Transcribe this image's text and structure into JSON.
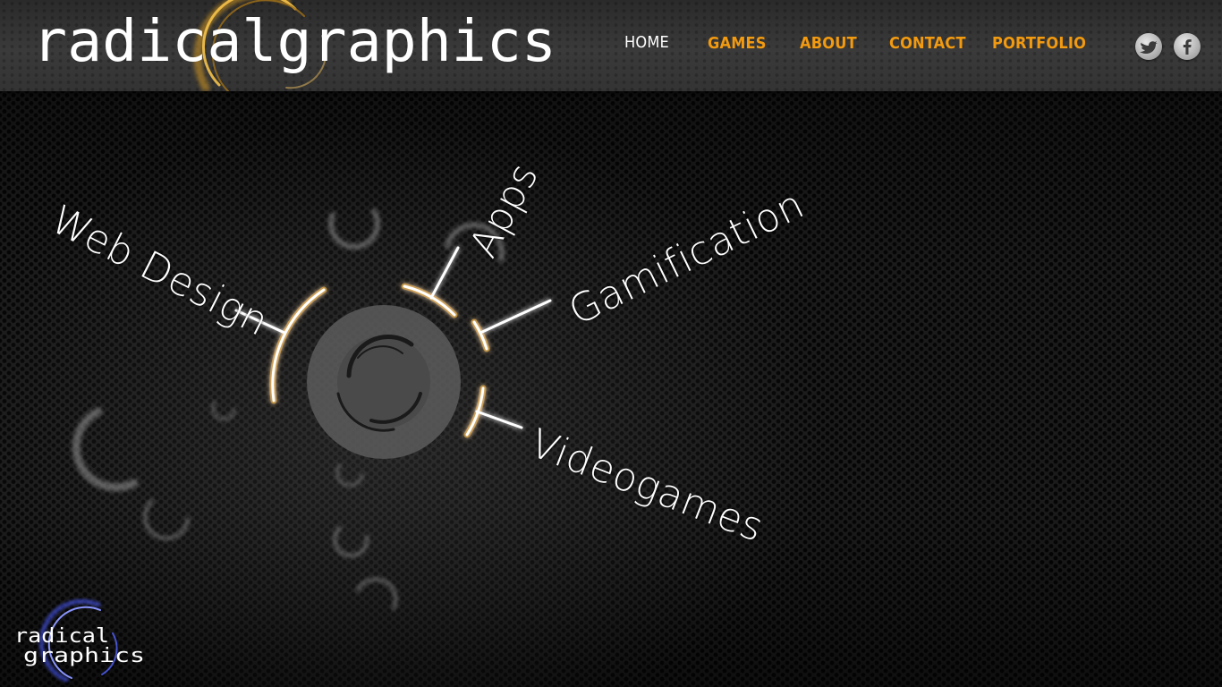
{
  "header": {
    "logo_text": "radicalgraphics",
    "nav": [
      {
        "label": "HOME",
        "active": true
      },
      {
        "label": "GAMES",
        "active": false
      },
      {
        "label": "ABOUT",
        "active": false
      },
      {
        "label": "CONTACT",
        "active": false
      },
      {
        "label": "PORTFOLIO",
        "active": false
      }
    ],
    "social": [
      {
        "name": "twitter-icon"
      },
      {
        "name": "facebook-icon"
      }
    ]
  },
  "hero": {
    "labels": {
      "web_design": "Web Design",
      "apps": "Apps",
      "gamification": "Gamification",
      "videogames": "Videogames"
    }
  },
  "footer": {
    "logo_line1": "radical",
    "logo_line2": "graphics"
  },
  "colors": {
    "accent": "#f29a10",
    "nav_active": "#ffffff",
    "glow": "#f5b21a",
    "footer_swirl": "#4b5cff"
  }
}
